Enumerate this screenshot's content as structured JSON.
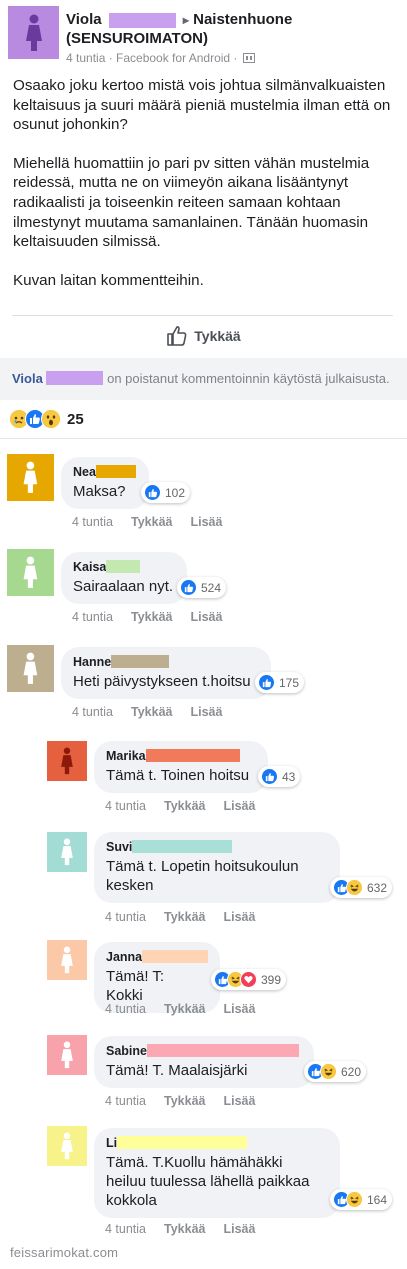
{
  "post": {
    "author": "Viola",
    "arrow": "▸",
    "group_line1": "Naistenhuone",
    "group_line2": "(SENSUROIMATON)",
    "meta": "4 tuntia · Facebook for Android ·",
    "paragraphs": [
      "Osaako joku kertoo mistä vois johtua silmänvalkuaisten keltaisuus ja suuri määrä pieniä mustelmia ilman että on osunut johonkin?",
      "Miehellä huomattiin jo pari pv sitten vähän mustelmia reidessä, mutta ne on viimeyön aikana lisääntynyt radikaalisti ja toiseenkin reiteen samaan kohtaan ilmestynyt muutama samanlainen. Tänään huomasin keltaisuuden silmissä.",
      "Kuvan laitan kommentteihin."
    ],
    "like_label": "Tykkää",
    "notice_name": "Viola",
    "notice_text": "on poistanut kommentoinnin käytöstä julkaisusta.",
    "reaction_count": "25",
    "avatar_color": "#b88be0",
    "redact_color": "#c9a0ef"
  },
  "comments": [
    {
      "name": "Nea",
      "text": "Maksa?",
      "reactions": "102",
      "avatar_color": "#e6a800",
      "redact_color": "#e6a800",
      "time": "4 tuntia",
      "like": "Tykkää",
      "reply": "Lisää"
    },
    {
      "name": "Kaisa",
      "text": "Sairaalaan nyt.",
      "reactions": "524",
      "avatar_color": "#a6d890",
      "redact_color": "#c3e8b0",
      "time": "4 tuntia",
      "like": "Tykkää",
      "reply": "Lisää"
    },
    {
      "name": "Hanne",
      "text": "Heti päivystykseen t.hoitsu",
      "reactions": "175",
      "avatar_color": "#bcae8e",
      "redact_color": "#bcae8e",
      "time": "4 tuntia",
      "like": "Tykkää",
      "reply": "Lisää"
    },
    {
      "name": "Marika",
      "text": "Tämä t. Toinen hoitsu",
      "reactions": "43",
      "avatar_color": "#e5603f",
      "redact_color": "#f07a5a",
      "time": "4 tuntia",
      "like": "Tykkää",
      "reply": "Lisää"
    },
    {
      "name": "Suvi",
      "text": "Tämä t. Lopetin hoitsukoulun kesken",
      "reactions": "632",
      "avatar_color": "#a3dcd5",
      "redact_color": "#a8e0d8",
      "time": "4 tuntia",
      "like": "Tykkää",
      "reply": "Lisää"
    },
    {
      "name": "Janna",
      "text": "Tämä! T: Kokki",
      "reactions": "399",
      "avatar_color": "#fbc9a8",
      "redact_color": "#ffd4b3",
      "time": "4 tuntia",
      "like": "Tykkää",
      "reply": "Lisää"
    },
    {
      "name": "Sabine",
      "text": "Tämä! T. Maalaisjärki",
      "reactions": "620",
      "avatar_color": "#f8a2ab",
      "redact_color": "#fba8b4",
      "time": "4 tuntia",
      "like": "Tykkää",
      "reply": "Lisää"
    },
    {
      "name": "Li",
      "text": "Tämä. T.Kuollu hämähäkki heiluu tuulessa lähellä paikkaa kokkola",
      "reactions": "164",
      "avatar_color": "#f7f28a",
      "redact_color": "#ffff99",
      "time": "4 tuntia",
      "like": "Tykkää",
      "reply": "Lisää"
    }
  ],
  "watermark": "feissarimokat.com"
}
